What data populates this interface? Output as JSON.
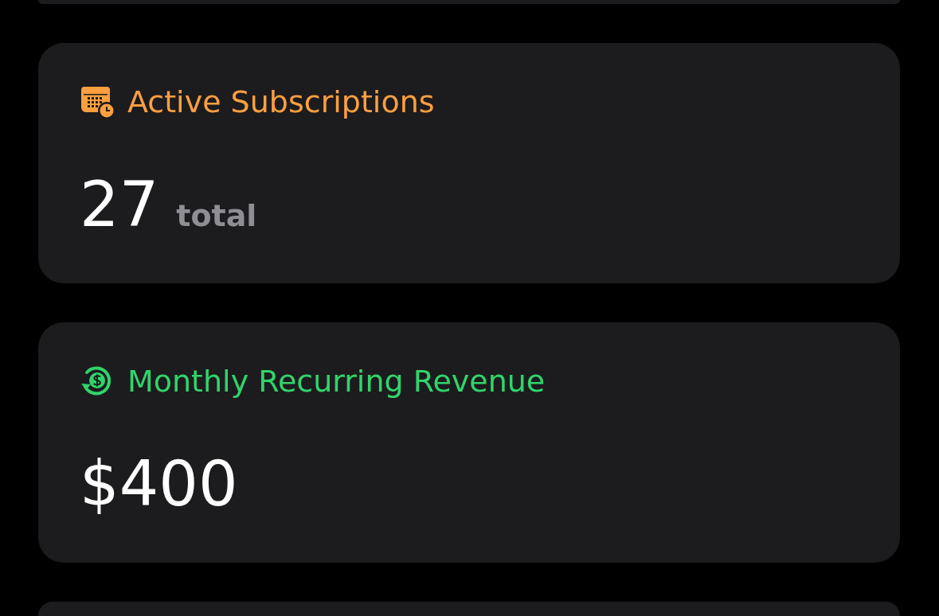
{
  "cards": [
    {
      "kind": "calendar",
      "color": "#ff9f3f",
      "title": "Active Subscriptions",
      "value": "27",
      "unit": "total"
    },
    {
      "kind": "revenue",
      "color": "#30d46a",
      "title": "Monthly Recurring Revenue",
      "value": "$400"
    }
  ]
}
